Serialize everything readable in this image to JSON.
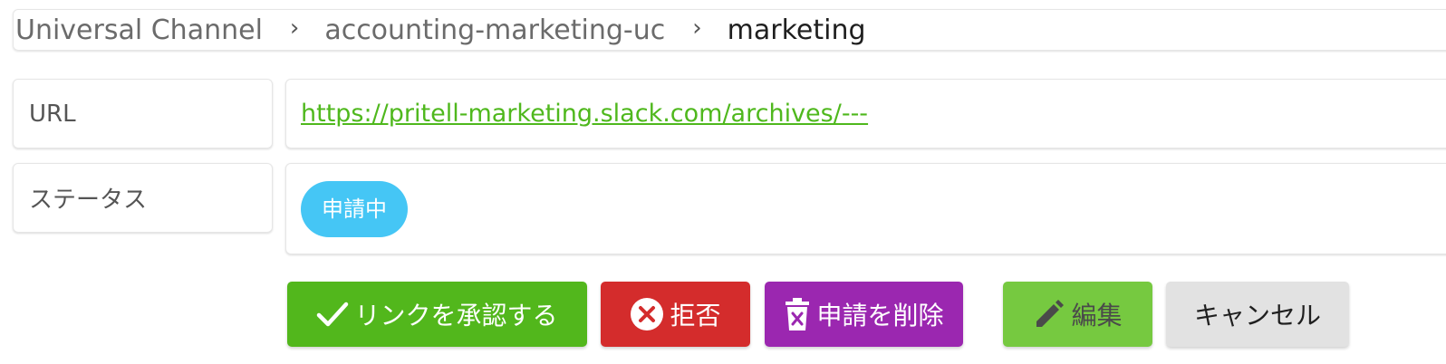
{
  "breadcrumb": {
    "items": [
      "Universal Channel",
      "accounting-marketing-uc",
      "marketing"
    ],
    "separator": "›"
  },
  "fields": {
    "url_label": "URL",
    "url_value": "https://pritell-marketing.slack.com/archives/---",
    "status_label": "ステータス",
    "status_value": "申請中"
  },
  "actions": {
    "approve": "リンクを承認する",
    "reject": "拒否",
    "delete": "申請を削除",
    "edit": "編集",
    "cancel": "キャンセル"
  },
  "icons": {
    "approve": "check-icon",
    "reject": "close-circle-icon",
    "delete": "trash-icon",
    "edit": "pencil-icon",
    "separator": "chevron-right-icon"
  },
  "colors": {
    "approve": "#52b71c",
    "reject": "#d42c2c",
    "delete": "#9b27b0",
    "edit": "#76c940",
    "cancel": "#e2e2e2",
    "link": "#4fb81d",
    "status_badge": "#45c6f5"
  }
}
